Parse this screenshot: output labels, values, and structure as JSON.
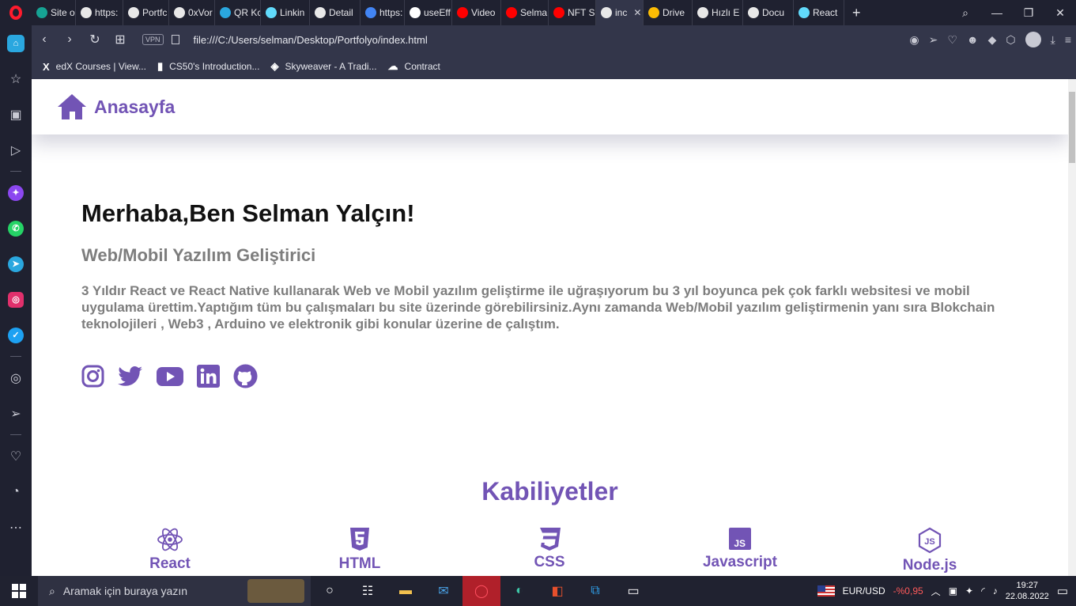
{
  "browser": {
    "tabs": [
      {
        "label": "Site o",
        "color": "#16a394"
      },
      {
        "label": "https:",
        "color": "#e8e8e8"
      },
      {
        "label": "Portfc",
        "color": "#e8e8e8"
      },
      {
        "label": "0xVor",
        "color": "#e8e8e8"
      },
      {
        "label": "QR Kc",
        "color": "#2aa7df"
      },
      {
        "label": "Linkin",
        "color": "#61dafb"
      },
      {
        "label": "Detail",
        "color": "#e8e8e8"
      },
      {
        "label": "https:",
        "color": "#4285f4"
      },
      {
        "label": "useEff",
        "color": "#ffffff"
      },
      {
        "label": "Video",
        "color": "#ff0000"
      },
      {
        "label": "Selma",
        "color": "#ff0000"
      },
      {
        "label": "NFT S",
        "color": "#ff0000"
      },
      {
        "label": "inc",
        "color": "#e8e8e8",
        "active": true
      },
      {
        "label": "Drive",
        "color": "#fbbc04"
      },
      {
        "label": "Hızlı E",
        "color": "#e8e8e8"
      },
      {
        "label": "Docu",
        "color": "#e8e8e8"
      },
      {
        "label": "React",
        "color": "#61dafb"
      }
    ],
    "new_tab": "+",
    "vpn_label": "VPN",
    "url": "file:///C:/Users/selman/Desktop/Portfolyo/index.html",
    "bookmarks": [
      {
        "icon": "X",
        "label": "edX Courses | View..."
      },
      {
        "icon": "▮",
        "label": "CS50's Introduction..."
      },
      {
        "icon": "◈",
        "label": "Skyweaver - A Tradi..."
      },
      {
        "icon": "☁",
        "label": "Contract"
      }
    ]
  },
  "page": {
    "nav": {
      "home_label": "Anasayfa"
    },
    "hero": {
      "title": "Merhaba,Ben Selman Yalçın!",
      "subtitle": "Web/Mobil Yazılım Geliştirici",
      "bio": "3 Yıldır React ve React Native kullanarak Web ve Mobil yazılım geliştirme ile uğraşıyorum bu 3 yıl boyunca pek çok farklı websitesi ve mobil uygulama ürettim.Yaptığım tüm bu çalışmaları bu site üzerinde görebilirsiniz.Aynı zamanda Web/Mobil yazılım geliştirmenin yanı sıra Blokchain teknolojileri , Web3 , Arduino ve elektronik gibi konular üzerine de çalıştım."
    },
    "socials": [
      "instagram-icon",
      "twitter-icon",
      "youtube-icon",
      "linkedin-icon",
      "github-icon"
    ],
    "skills_title": "Kabiliyetler",
    "skills": [
      {
        "label": "React",
        "icon": "react-icon"
      },
      {
        "label": "HTML",
        "icon": "html5-icon"
      },
      {
        "label": "CSS",
        "icon": "css3-icon"
      },
      {
        "label": "Javascript",
        "icon": "javascript-icon"
      },
      {
        "label": "Node.js",
        "icon": "nodejs-icon"
      }
    ],
    "accent_color": "#7254b5"
  },
  "taskbar": {
    "search_placeholder": "Aramak için buraya yazın",
    "fx_pair": "EUR/USD",
    "fx_change": "-%0,95",
    "time": "19:27",
    "date": "22.08.2022"
  }
}
